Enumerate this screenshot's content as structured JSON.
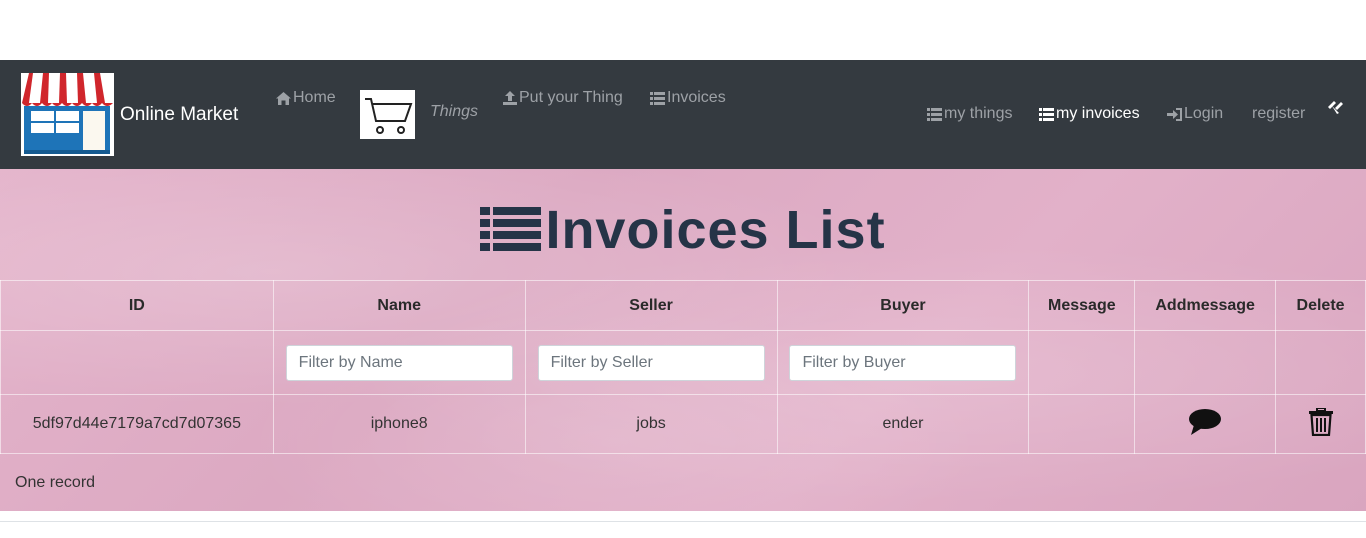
{
  "navbar": {
    "brand": "Online Market",
    "home": "Home",
    "things": "Things",
    "put": "Put your Thing",
    "invoices": "Invoices",
    "my_things": "my things",
    "my_invoices": "my invoices",
    "login": "Login",
    "register": "register"
  },
  "page": {
    "title": "Invoices List"
  },
  "table": {
    "headers": [
      "ID",
      "Name",
      "Seller",
      "Buyer",
      "Message",
      "Addmessage",
      "Delete"
    ],
    "filters": {
      "name": "Filter by Name",
      "seller": "Filter by Seller",
      "buyer": "Filter by Buyer"
    },
    "rows": [
      {
        "id": "5df97d44e7179a7cd7d07365",
        "name": "iphone8",
        "seller": "jobs",
        "buyer": "ender",
        "message": ""
      }
    ]
  },
  "footer": {
    "record_count": "One record"
  },
  "colors": {
    "navbar": "#343a40",
    "title": "#253447",
    "background": "#e0afc7"
  }
}
